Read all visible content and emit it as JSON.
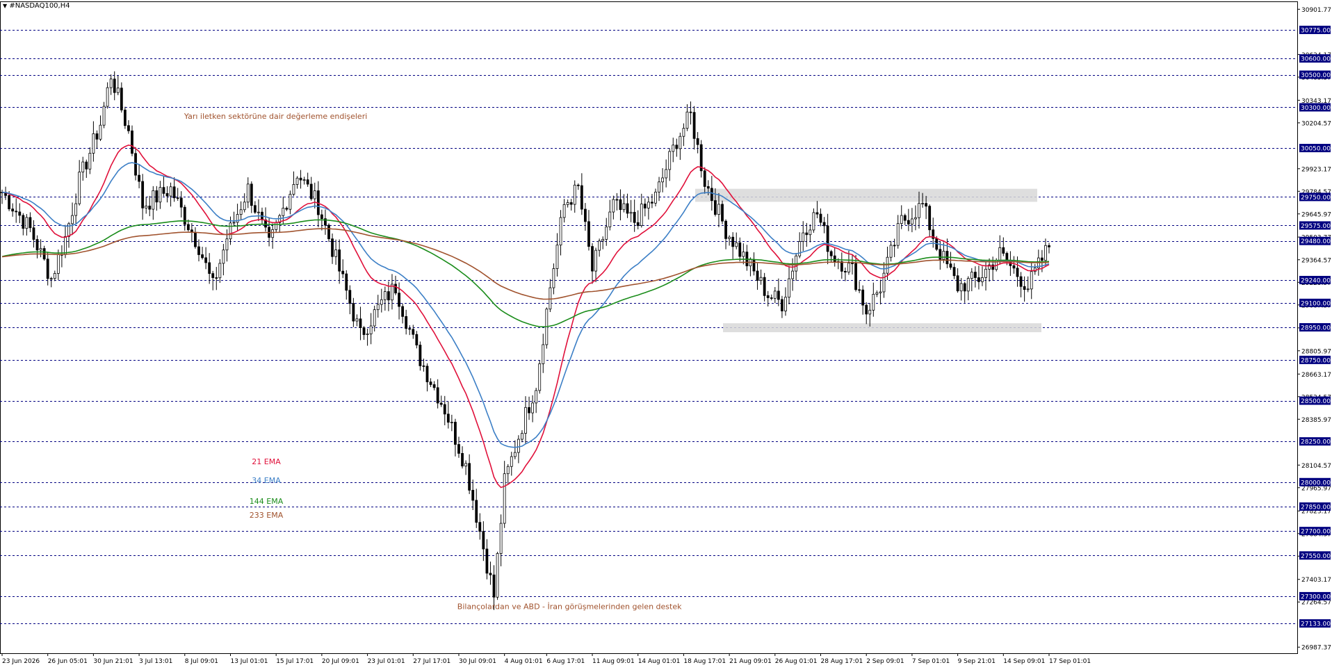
{
  "window": {
    "symbol_title": "#NASDAQ100,H4"
  },
  "colors": {
    "background": "#ffffff",
    "grid_line": "#000080",
    "candle": "#000000",
    "ema21": "#e0103a",
    "ema34": "#3c7fc6",
    "ema144": "#1a8c1a",
    "ema233": "#a0522d",
    "annotation": "#a0522d",
    "price_label_bg": "#000080",
    "price_label_text": "#ffffff",
    "zone_fill": "#d8d8d8"
  },
  "chart_data": {
    "type": "candlestick",
    "title": "#NASDAQ100,H4",
    "ylim": [
      26950,
      30950
    ],
    "y_ticks": [
      "30901.77",
      "30624.17",
      "30485.37",
      "30343.17",
      "30204.57",
      "29923.17",
      "29784.57",
      "29645.97",
      "29503.77",
      "29364.57",
      "29225.97",
      "29087.37",
      "28946.57",
      "28805.97",
      "28663.17",
      "28524.57",
      "28385.97",
      "28104.57",
      "27965.97",
      "27823.17",
      "27684.37",
      "27545.77",
      "27403.17",
      "27264.57",
      "26987.37"
    ],
    "highlighted_levels": [
      {
        "value": 30775,
        "label": "30775.00"
      },
      {
        "value": 30600,
        "label": "30600.00"
      },
      {
        "value": 30500,
        "label": "30500.00"
      },
      {
        "value": 30300,
        "label": "30300.00"
      },
      {
        "value": 30050,
        "label": "30050.00"
      },
      {
        "value": 29750,
        "label": "29750.00"
      },
      {
        "value": 29575,
        "label": "29575.00"
      },
      {
        "value": 29480,
        "label": "29480.00"
      },
      {
        "value": 29240,
        "label": "29240.00"
      },
      {
        "value": 29100,
        "label": "29100.00"
      },
      {
        "value": 28950,
        "label": "28950.00"
      },
      {
        "value": 28750,
        "label": "28750.00"
      },
      {
        "value": 28500,
        "label": "28500.00"
      },
      {
        "value": 28250,
        "label": "28250.00"
      },
      {
        "value": 28000,
        "label": "28000.00"
      },
      {
        "value": 27850,
        "label": "27850.00"
      },
      {
        "value": 27700,
        "label": "27700.00"
      },
      {
        "value": 27550,
        "label": "27550.00"
      },
      {
        "value": 27300,
        "label": "27300.00"
      },
      {
        "value": 27133,
        "label": "27133.00"
      }
    ],
    "x_labels": [
      "23 Jun 2026",
      "26 Jun 05:01",
      "30 Jun 21:01",
      "3 Jul 13:01",
      "8 Jul 09:01",
      "13 Jul 01:01",
      "15 Jul 17:01",
      "20 Jul 09:01",
      "23 Jul 01:01",
      "27 Jul 17:01",
      "30 Jul 09:01",
      "4 Aug 01:01",
      "6 Aug 17:01",
      "11 Aug 09:01",
      "14 Aug 01:01",
      "18 Aug 17:01",
      "21 Aug 09:01",
      "26 Aug 01:01",
      "28 Aug 17:01",
      "2 Sep 09:01",
      "7 Sep 01:01",
      "9 Sep 21:01",
      "14 Sep 09:01",
      "17 Sep 01:01"
    ],
    "price_anchors": [
      [
        0,
        29780
      ],
      [
        8,
        29550
      ],
      [
        14,
        29250
      ],
      [
        18,
        29500
      ],
      [
        22,
        29850
      ],
      [
        28,
        30200
      ],
      [
        31,
        30500
      ],
      [
        36,
        30150
      ],
      [
        40,
        29700
      ],
      [
        48,
        29800
      ],
      [
        56,
        29450
      ],
      [
        60,
        29200
      ],
      [
        64,
        29500
      ],
      [
        70,
        29800
      ],
      [
        76,
        29450
      ],
      [
        84,
        29900
      ],
      [
        90,
        29700
      ],
      [
        96,
        29300
      ],
      [
        102,
        28900
      ],
      [
        108,
        29100
      ],
      [
        112,
        29200
      ],
      [
        118,
        28800
      ],
      [
        126,
        28450
      ],
      [
        132,
        28100
      ],
      [
        136,
        27700
      ],
      [
        140,
        27300
      ],
      [
        143,
        28000
      ],
      [
        148,
        28350
      ],
      [
        152,
        28600
      ],
      [
        156,
        29200
      ],
      [
        160,
        29700
      ],
      [
        164,
        29800
      ],
      [
        168,
        29300
      ],
      [
        174,
        29700
      ],
      [
        180,
        29600
      ],
      [
        186,
        29750
      ],
      [
        192,
        30100
      ],
      [
        196,
        30250
      ],
      [
        200,
        29850
      ],
      [
        206,
        29550
      ],
      [
        212,
        29350
      ],
      [
        218,
        29150
      ],
      [
        222,
        29100
      ],
      [
        228,
        29550
      ],
      [
        232,
        29650
      ],
      [
        236,
        29400
      ],
      [
        242,
        29300
      ],
      [
        246,
        29050
      ],
      [
        250,
        29200
      ],
      [
        256,
        29600
      ],
      [
        262,
        29700
      ],
      [
        266,
        29450
      ],
      [
        272,
        29200
      ],
      [
        278,
        29250
      ],
      [
        284,
        29400
      ],
      [
        292,
        29200
      ],
      [
        298,
        29450
      ]
    ],
    "emas": [
      {
        "name": "21 EMA",
        "period": 21,
        "color": "#e0103a"
      },
      {
        "name": "34 EMA",
        "period": 34,
        "color": "#3c7fc6"
      },
      {
        "name": "144 EMA",
        "period": 144,
        "color": "#1a8c1a"
      },
      {
        "name": "233 EMA",
        "period": 233,
        "color": "#a0522d"
      }
    ],
    "zones": [
      {
        "from": 29720,
        "to": 29800
      },
      {
        "from": 28920,
        "to": 28975
      }
    ],
    "annotations": [
      {
        "text": "Yarı iletken sektörüne dair değerleme endişeleri",
        "date_label": "8 Jul 09:01",
        "price": 30230
      },
      {
        "text": "Bilançolardan ve ABD - İran görüşmelerinden gelen destek",
        "date_label": "30 Jul 09:01",
        "price": 27220
      }
    ],
    "legend": [
      {
        "text": "21 EMA",
        "color": "#e0103a"
      },
      {
        "text": "34 EMA",
        "color": "#3c7fc6"
      },
      {
        "text": "144 EMA",
        "color": "#1a8c1a"
      },
      {
        "text": "233 EMA",
        "color": "#a0522d"
      }
    ]
  }
}
